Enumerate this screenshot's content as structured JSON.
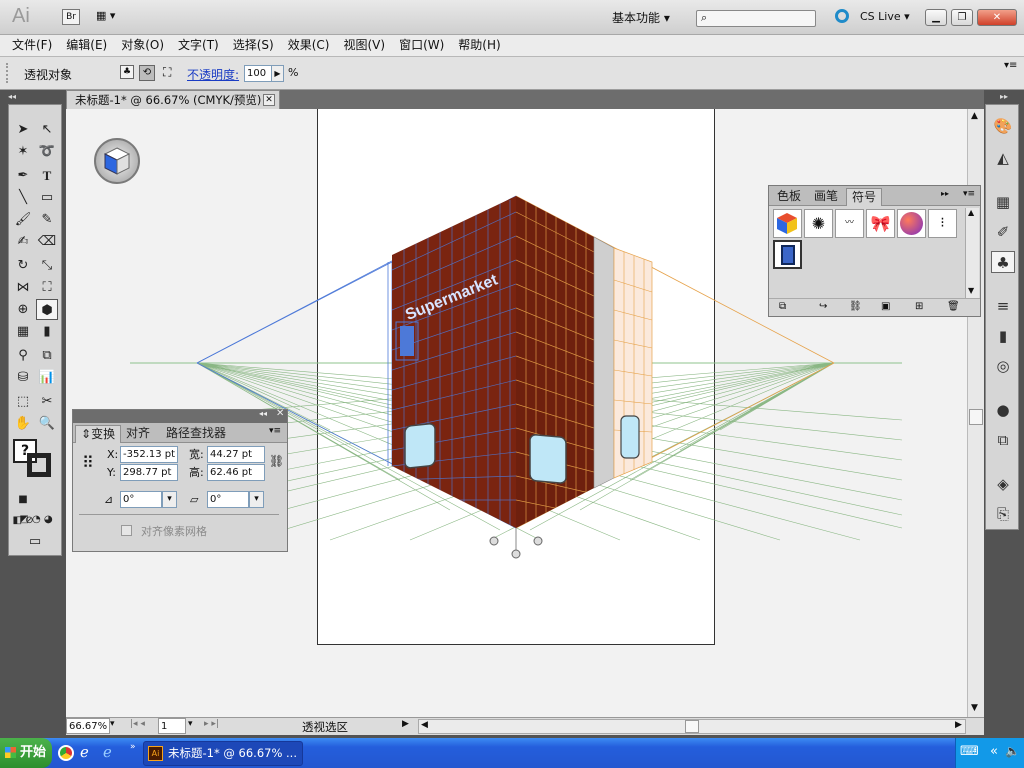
{
  "app": {
    "logo": "Ai",
    "bridge": "Br",
    "workspace": "基本功能",
    "cs_live": "CS Live"
  },
  "menu": [
    "文件(F)",
    "编辑(E)",
    "对象(O)",
    "文字(T)",
    "选择(S)",
    "效果(C)",
    "视图(V)",
    "窗口(W)",
    "帮助(H)"
  ],
  "control": {
    "object_label": "透视对象",
    "opacity_label": "不透明度:",
    "opacity_value": "100",
    "opacity_unit": "%"
  },
  "document": {
    "tab_title": "未标题-1* @ 66.67% (CMYK/预览)",
    "sign_text": "Supermarket"
  },
  "status": {
    "zoom": "66.67%",
    "page": "1",
    "info": "透视选区"
  },
  "transform_panel": {
    "tabs": [
      "变换",
      "对齐",
      "路径查找器"
    ],
    "x_label": "X:",
    "x_value": "-352.13 pt",
    "y_label": "Y:",
    "y_value": "298.77 pt",
    "w_label": "宽:",
    "w_value": "44.27 pt",
    "h_label": "高:",
    "h_value": "62.46 pt",
    "rotate_value": "0°",
    "shear_value": "0°",
    "align_pixel": "对齐像素网格"
  },
  "symbols_panel": {
    "tabs": [
      "色板",
      "画笔",
      "符号"
    ]
  },
  "taskbar": {
    "start": "开始",
    "task": "未标题-1* @ 66.67% ..."
  },
  "colors": {
    "building": "#7a2410",
    "grid_orange": "#e6a24a",
    "grid_blue": "#4d79d8",
    "grid_green": "#6aa266"
  }
}
